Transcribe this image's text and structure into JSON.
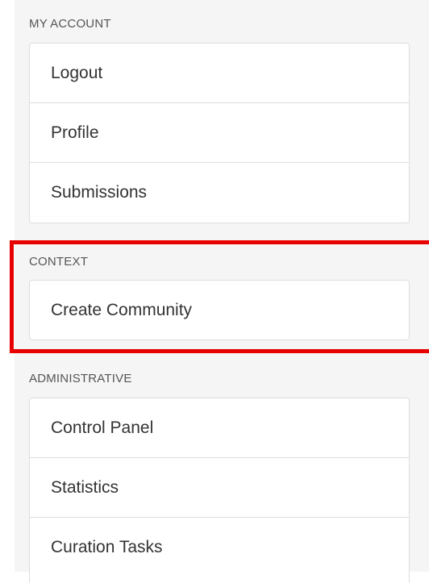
{
  "sections": {
    "my_account": {
      "heading": "MY ACCOUNT",
      "items": [
        {
          "label": "Logout"
        },
        {
          "label": "Profile"
        },
        {
          "label": "Submissions"
        }
      ]
    },
    "context": {
      "heading": "CONTEXT",
      "items": [
        {
          "label": "Create Community"
        }
      ]
    },
    "administrative": {
      "heading": "ADMINISTRATIVE",
      "items": [
        {
          "label": "Control Panel"
        },
        {
          "label": "Statistics"
        },
        {
          "label": "Curation Tasks"
        }
      ]
    }
  },
  "colors": {
    "highlight_border": "#e60000",
    "panel_background": "#f5f5f5",
    "item_border": "#dddddd"
  }
}
